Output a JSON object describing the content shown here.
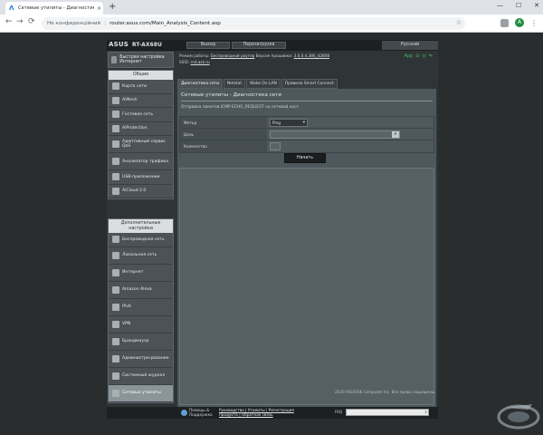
{
  "browser": {
    "tab_title": "Сетевые утилиты - Диагностика сети",
    "tab_close": "×",
    "new_tab": "+",
    "security": "Не конфиденційний",
    "url": "router.asus.com/Main_Analysis_Content.asp",
    "avatar_letter": "A",
    "back": "←",
    "forward": "→",
    "reload": "⟳",
    "star": "☆",
    "menu": "⋮",
    "win_min": "—",
    "win_max": "☐",
    "win_close": "✕"
  },
  "header": {
    "brand": "ASUS",
    "model": "RT-AX68U",
    "logout": "Выход",
    "reboot": "Перезагрузка",
    "language": "Русский"
  },
  "info": {
    "mode_label": "Режим работы:",
    "mode_value": "Беспроводной роутер",
    "fw_label": "Версия прошивки:",
    "fw_value": "3.0.0.4.386_42808",
    "ssid_label": "SSID:",
    "ssid_value": "rnd.ask.ru",
    "app_label": "App"
  },
  "sidebar": {
    "quick_setup": "Быстрая настройка Интернет",
    "general_header": "Общие",
    "general": [
      {
        "label": "Карта сети"
      },
      {
        "label": "AiMesh"
      },
      {
        "label": "Гостевая сеть"
      },
      {
        "label": "AiProtection"
      },
      {
        "label": "Адаптивный сервис QoS"
      },
      {
        "label": "Анализатор трафика"
      },
      {
        "label": "USB-приложение"
      },
      {
        "label": "AiCloud 2.0"
      }
    ],
    "advanced_header": "Дополнительные настройки",
    "advanced": [
      {
        "label": "Беспроводная сеть"
      },
      {
        "label": "Локальная сеть"
      },
      {
        "label": "Интернет"
      },
      {
        "label": "Amazon Alexa"
      },
      {
        "label": "IPv6"
      },
      {
        "label": "VPN"
      },
      {
        "label": "Брандмауэр"
      },
      {
        "label": "Администри-рование"
      },
      {
        "label": "Системный журнал"
      },
      {
        "label": "Сетевые утилиты"
      }
    ]
  },
  "tabs": [
    {
      "label": "Диагностика сети"
    },
    {
      "label": "Netstat"
    },
    {
      "label": "Wake On LAN"
    },
    {
      "label": "Правило Smart Connect"
    }
  ],
  "main": {
    "title": "Сетевые утилиты - Диагностика сети",
    "description": "Отправка пакетов ICMP ECHO_REQUEST на сетевой хост.",
    "method_label": "Метод",
    "method_value": "Ping",
    "target_label": "Цель",
    "target_value": "",
    "count_label": "Количество",
    "count_value": "",
    "run": "Начать",
    "dropdown": "▾"
  },
  "footer": {
    "help": "Помощь & Поддержка",
    "links_line1": "Руководство | Утилиты | Регистрация",
    "links_line2": "продукта | Обратная связь",
    "faq": "FAQ",
    "search_icon": "⌕",
    "copyright": "2020 ASUSTeK Computer Inc. Все права защищены."
  }
}
